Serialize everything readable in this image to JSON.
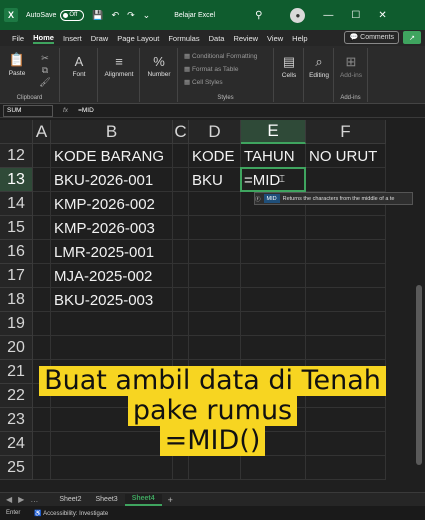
{
  "titlebar": {
    "autosave_label": "AutoSave",
    "autosave_state": "Off",
    "doc_title": "Belajar Excel"
  },
  "menu": [
    "File",
    "Home",
    "Insert",
    "Draw",
    "Page Layout",
    "Formulas",
    "Data",
    "Review",
    "View",
    "Help"
  ],
  "menu_active": "Home",
  "comments_label": "Comments",
  "ribbon": {
    "paste": "Paste",
    "clipboard": "Clipboard",
    "font": "Font",
    "alignment": "Alignment",
    "number": "Number",
    "conditional_formatting": "Conditional Formatting",
    "format_as_table": "Format as Table",
    "cell_styles": "Cell Styles",
    "styles": "Styles",
    "cells": "Cells",
    "editing": "Editing",
    "addins": "Add-ins",
    "addins_group": "Add-ins"
  },
  "formula_bar": {
    "name_box": "SUM",
    "fx": "fx",
    "content": "=MID"
  },
  "columns": [
    "A",
    "B",
    "C",
    "D",
    "E",
    "F"
  ],
  "rows": [
    "12",
    "13",
    "14",
    "15",
    "16",
    "17",
    "18",
    "19",
    "20",
    "21",
    "22",
    "23",
    "24",
    "25"
  ],
  "cells": {
    "B12": "KODE BARANG",
    "D12": "KODE",
    "E12": "TAHUN",
    "F12": "NO URUT",
    "B13": "BKU-2026-001",
    "D13": "BKU",
    "E13": "=MID",
    "B14": "KMP-2026-002",
    "B15": "KMP-2026-003",
    "B16": "LMR-2025-001",
    "B17": "MJA-2025-002",
    "B18": "BKU-2025-003"
  },
  "autocomplete": {
    "function": "MID",
    "description": "Returns the characters from the middle of a te"
  },
  "caption": [
    "Buat ambil data di Tenah",
    "pake rumus",
    "=MID()"
  ],
  "sheets": [
    "Sheet2",
    "Sheet3",
    "Sheet4"
  ],
  "active_sheet": "Sheet4",
  "status": {
    "mode": "Enter",
    "accessibility": "Accessibility: Investigate"
  },
  "colors": {
    "accent": "#3fa45f",
    "caption_bg": "#f7d521",
    "titlebar": "#0f5c2e"
  }
}
